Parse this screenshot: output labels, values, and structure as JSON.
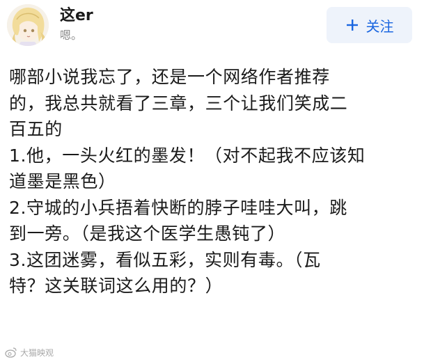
{
  "author": {
    "name": "这er",
    "bio": "嗯。"
  },
  "follow_button": {
    "label": "关注",
    "accent": "#1a66e0",
    "background": "#eef3fb"
  },
  "post": {
    "lines": [
      "哪部小说我忘了，还是一个网络作者推荐",
      "的，我总共就看了三章，三个让我们笑成二",
      "百五的",
      "1.他，一头火红的墨发！（对不起我不应该知",
      "道墨是黑色）",
      "2.守城的小兵捂着快断的脖子哇哇大叫，跳",
      "到一旁。（是我这个医学生愚钝了）",
      "3.这团迷雾，看似五彩，实则有毒。（瓦",
      "特？这关联词这么用的？）"
    ]
  },
  "watermark": {
    "text": "大猫映观",
    "icon": "weibo-icon"
  }
}
